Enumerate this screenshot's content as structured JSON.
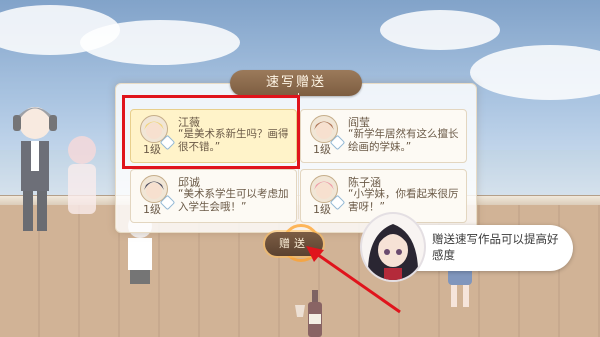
{
  "colors": {
    "highlight_box": "#e0141c",
    "arrow": "#e0141c",
    "panel_bg": "#fdfaf4",
    "selected_card": "#fff3c9"
  },
  "dialog": {
    "title": "速写赠送"
  },
  "cards": [
    {
      "name": "江薇",
      "quote": "“是美术系新生吗？画得很不错。”",
      "level": "1级",
      "selected": true,
      "icon": "blonde-girl-portrait"
    },
    {
      "name": "阎莹",
      "quote": "“新学年居然有这么擅长绘画的学妹。”",
      "level": "1级",
      "selected": false,
      "icon": "brown-hair-girl-portrait"
    },
    {
      "name": "邱诚",
      "quote": "“美术系学生可以考虑加入学生会哦！”",
      "level": "1级",
      "selected": false,
      "icon": "dark-hair-boy-portrait"
    },
    {
      "name": "陈子涵",
      "quote": "“小学妹，你看起来很厉害呀！”",
      "level": "1级",
      "selected": false,
      "icon": "pink-hair-girl-portrait"
    }
  ],
  "gift_button": {
    "label": "赠送"
  },
  "guide": {
    "text": "赠送速写作品可以提高好感度",
    "icon": "guide-girl-portrait"
  }
}
